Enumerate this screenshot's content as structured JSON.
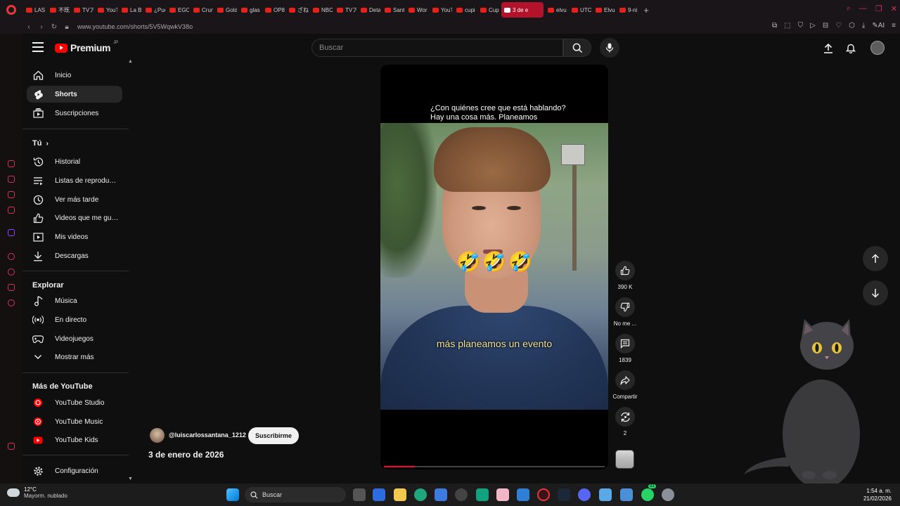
{
  "browser": {
    "tabs": [
      {
        "label": "LAS",
        "active": false
      },
      {
        "label": "不既",
        "active": false
      },
      {
        "label": "TVア",
        "active": false
      },
      {
        "label": "YouT",
        "active": false
      },
      {
        "label": "La B",
        "active": false
      },
      {
        "label": "¿Pue",
        "active": false
      },
      {
        "label": "EGO",
        "active": false
      },
      {
        "label": "Crun",
        "active": false
      },
      {
        "label": "Gold",
        "active": false
      },
      {
        "label": "glas",
        "active": false
      },
      {
        "label": "OP8",
        "active": false
      },
      {
        "label": "ざね",
        "active": false
      },
      {
        "label": "NBC",
        "active": false
      },
      {
        "label": "TVア",
        "active": false
      },
      {
        "label": "Deta",
        "active": false
      },
      {
        "label": "Sant",
        "active": false
      },
      {
        "label": "Wor",
        "active": false
      },
      {
        "label": "YouT",
        "active": false
      },
      {
        "label": "cupi",
        "active": false
      },
      {
        "label": "Cup",
        "active": false
      },
      {
        "label": "3 de e",
        "active": true
      },
      {
        "label": "elvu",
        "active": false
      },
      {
        "label": "UTC",
        "active": false
      },
      {
        "label": "Elvu",
        "active": false
      },
      {
        "label": "9-ni",
        "active": false
      }
    ],
    "url": "www.youtube.com/shorts/5V5WqwkV38o",
    "accent": "#e5383b"
  },
  "header": {
    "brand": "Premium",
    "region": "JP",
    "search_placeholder": "Buscar"
  },
  "sidebar": {
    "main_items": [
      {
        "label": "Inicio",
        "icon": "home-icon",
        "active": false
      },
      {
        "label": "Shorts",
        "icon": "shorts-icon",
        "active": true
      },
      {
        "label": "Suscripciones",
        "icon": "subscriptions-icon",
        "active": false
      }
    ],
    "you_heading": "Tú",
    "you_items": [
      {
        "label": "Historial",
        "icon": "history-icon"
      },
      {
        "label": "Listas de reproducc...",
        "icon": "playlist-icon"
      },
      {
        "label": "Ver más tarde",
        "icon": "clock-icon"
      },
      {
        "label": "Videos que me gus...",
        "icon": "thumbs-up-icon"
      },
      {
        "label": "Mis videos",
        "icon": "video-icon"
      },
      {
        "label": "Descargas",
        "icon": "download-icon"
      }
    ],
    "explore_heading": "Explorar",
    "explore_items": [
      {
        "label": "Música",
        "icon": "music-icon"
      },
      {
        "label": "En directo",
        "icon": "live-icon"
      },
      {
        "label": "Videojuegos",
        "icon": "gaming-icon"
      },
      {
        "label": "Mostrar más",
        "icon": "chevron-down-icon"
      }
    ],
    "more_heading": "Más de YouTube",
    "more_items": [
      {
        "label": "YouTube Studio",
        "icon": "yt-studio-icon"
      },
      {
        "label": "YouTube Music",
        "icon": "yt-music-icon"
      },
      {
        "label": "YouTube Kids",
        "icon": "yt-kids-icon"
      }
    ],
    "settings_label": "Configuración"
  },
  "short": {
    "question_line1": "¿Con quiénes cree que está hablando?",
    "question_line2": "Hay una cosa más. Planeamos",
    "emojis": "🤣🤣🤣",
    "caption": "más planeamos un evento",
    "progress": 0.14,
    "progress_color": "#ff0033"
  },
  "actions": {
    "likes": "390 K",
    "dislike_label": "No me ...",
    "comments": "1839",
    "share_label": "Compartir",
    "remix_count": "2"
  },
  "channel": {
    "handle": "@luiscarlossantana_1212",
    "subscribe_label": "Suscribirme",
    "date": "3 de enero de 2026"
  },
  "taskbar": {
    "temperature": "12°C",
    "weather": "Mayorm. nublado",
    "search_label": "Buscar",
    "time": "1:54 a. m.",
    "date": "21/02/2026",
    "whatsapp_badge": "31"
  }
}
